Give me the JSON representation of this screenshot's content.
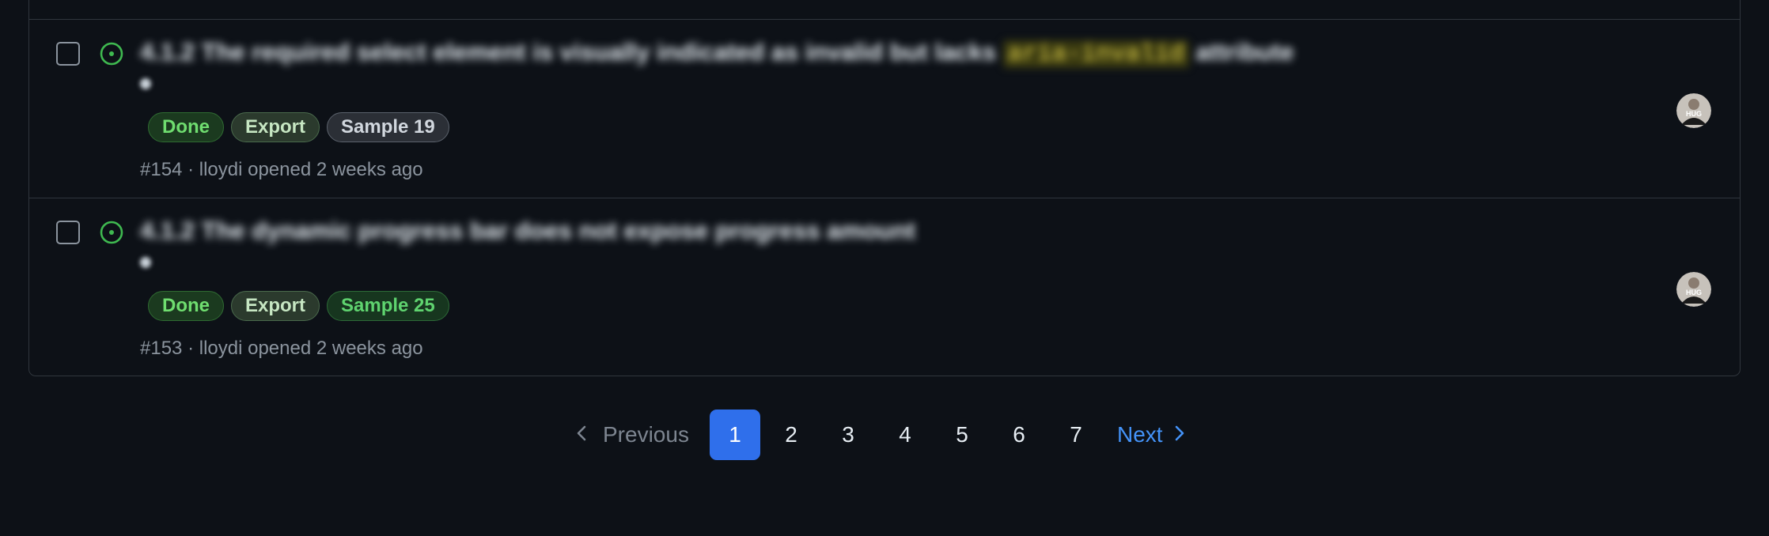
{
  "issues": [
    {
      "title_prefix": "4.1.2 The required select element is visually indicated as invalid but lacks",
      "title_code": "aria-invalid",
      "title_suffix": "attribute",
      "labels": {
        "done": "Done",
        "export": "Export",
        "sample": "Sample 19"
      },
      "number": "#154",
      "separator": "·",
      "author": "lloydi",
      "opened": "opened 2 weeks ago",
      "avatar_text": "HUG"
    },
    {
      "title_prefix": "4.1.2 The dynamic progress bar does not expose progress amount",
      "title_code": "",
      "title_suffix": "",
      "labels": {
        "done": "Done",
        "export": "Export",
        "sample": "Sample 25"
      },
      "number": "#153",
      "separator": "·",
      "author": "lloydi",
      "opened": "opened 2 weeks ago",
      "avatar_text": "HUG"
    }
  ],
  "pagination": {
    "previous": "Previous",
    "next": "Next",
    "pages": [
      "1",
      "2",
      "3",
      "4",
      "5",
      "6",
      "7"
    ],
    "current": "1"
  },
  "colors": {
    "background": "#0d1117",
    "open_icon": "#3fb950",
    "accent": "#2f6feb",
    "link": "#4493f8"
  },
  "icons": {
    "status": "issue-open-icon",
    "previous": "chevron-left-icon",
    "next": "chevron-right-icon"
  }
}
